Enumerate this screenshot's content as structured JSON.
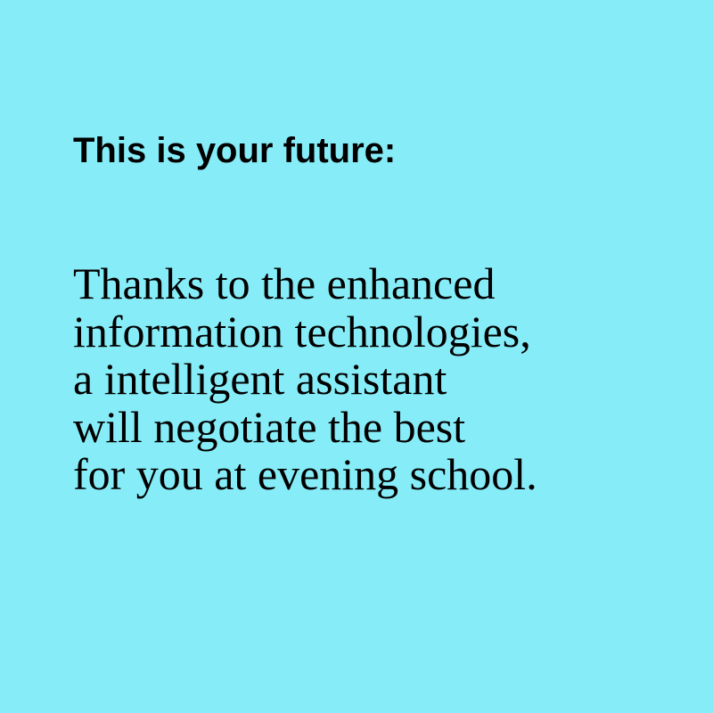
{
  "page": {
    "background_color": "#86edf8",
    "text_color": "#000000"
  },
  "heading": "This is your future:",
  "body_lines": [
    "Thanks to the enhanced",
    "information technologies,",
    "a intelligent assistant",
    "will negotiate the best",
    "for you at evening school."
  ]
}
